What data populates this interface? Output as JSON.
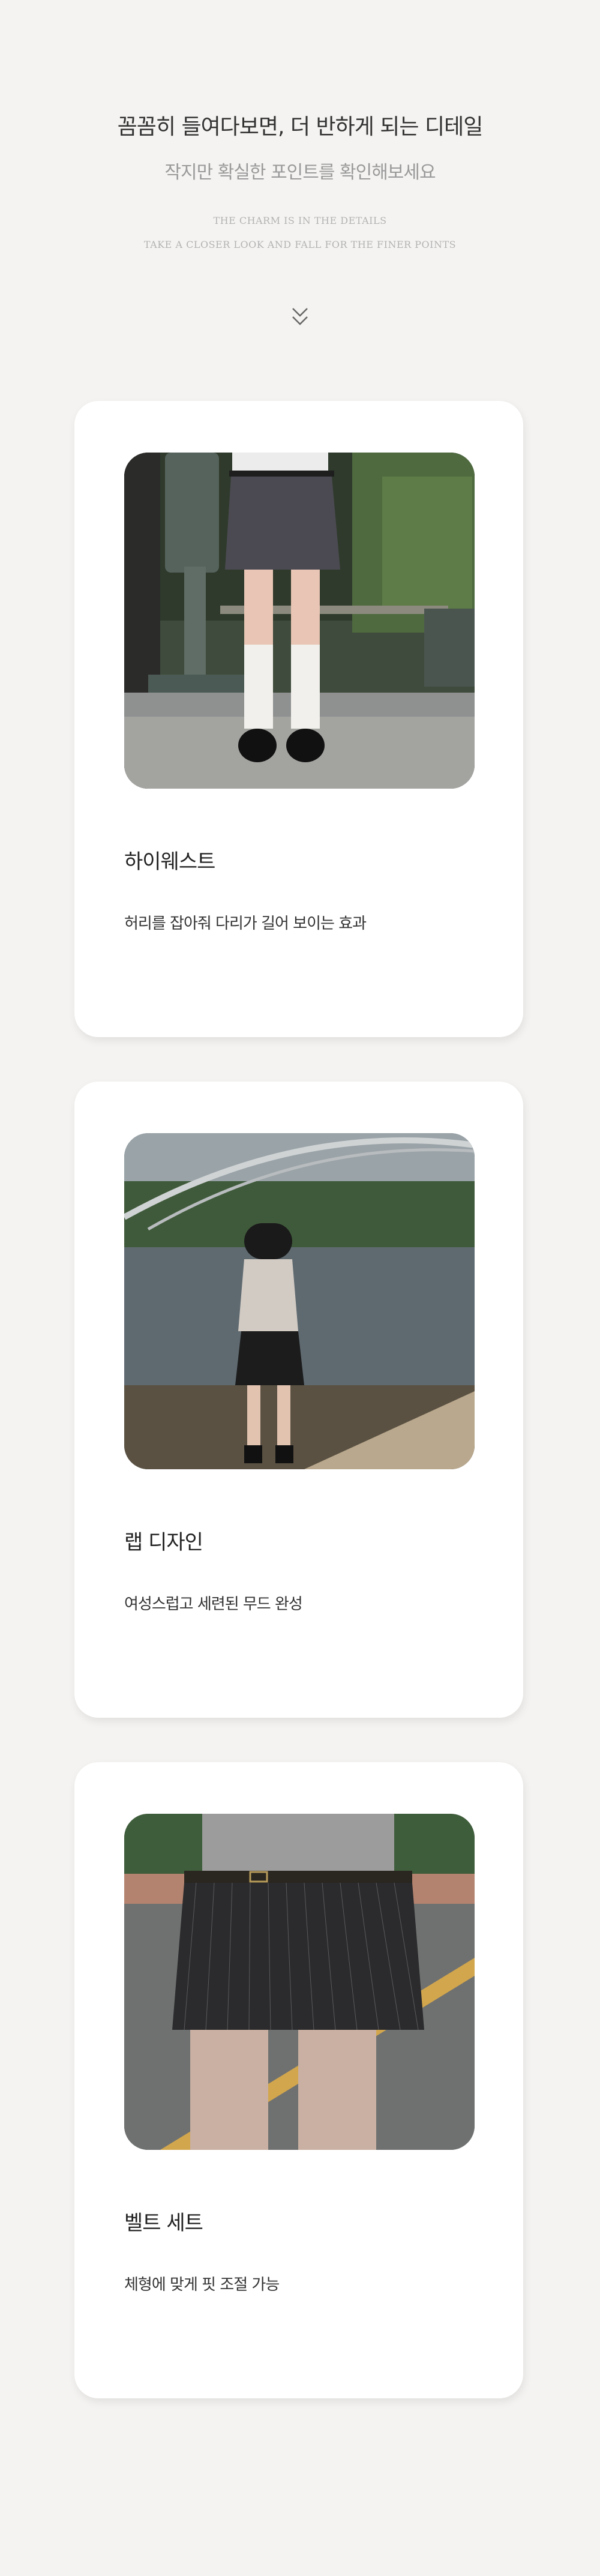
{
  "intro": {
    "headline": "꼼꼼히 들여다보면, 더 반하게 되는 디테일",
    "subheadline": "작지만 확실한 포인트를 확인해보세요",
    "caption_line1": "THE CHARM IS IN THE DETAILS",
    "caption_line2": "TAKE A CLOSER LOOK AND FALL FOR THE FINER POINTS",
    "scroll_icon": "double-chevron-down-icon"
  },
  "details": [
    {
      "title": "하이웨스트",
      "description": "허리를 잡아줘 다리가 길어 보이는 효과",
      "photo": "model-high-waist-skirt-photo"
    },
    {
      "title": "랩 디자인",
      "description": "여성스럽고 세련된 무드 완성",
      "photo": "model-riverside-wrap-skirt-photo"
    },
    {
      "title": "벨트 세트",
      "description": "체형에 맞게 핏 조절 가능",
      "photo": "pinstripe-skirt-belt-closeup-photo"
    }
  ],
  "colors": {
    "page_background": "#f4f3f1",
    "card_background": "#ffffff",
    "headline_text": "#333333",
    "subheadline_text": "#9a9a9a",
    "caption_text": "#b3b3b3"
  }
}
